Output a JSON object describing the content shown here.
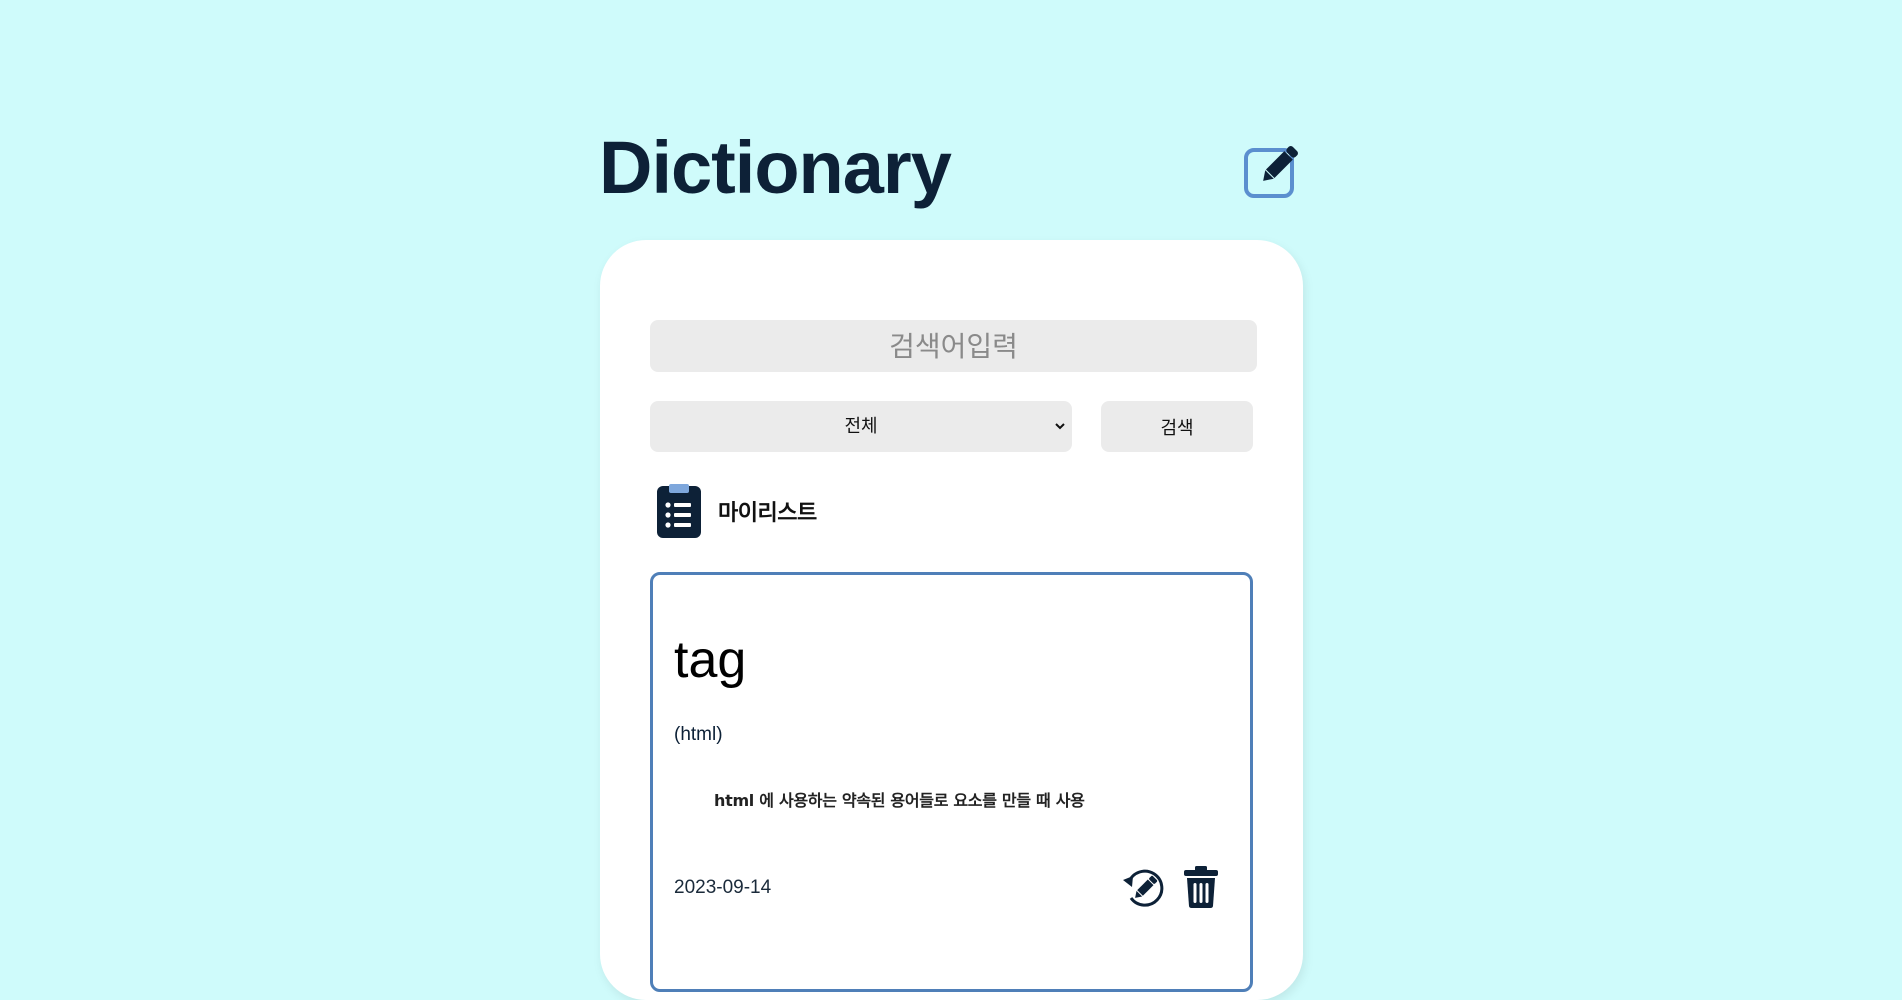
{
  "header": {
    "title": "Dictionary",
    "write_icon": "pen-to-square-icon"
  },
  "search": {
    "placeholder": "검색어입력",
    "value": ""
  },
  "filter": {
    "selected": "전체",
    "options": [
      "전체"
    ]
  },
  "search_button": {
    "label": "검색"
  },
  "mylist": {
    "icon": "clipboard-list-icon",
    "label": "마이리스트"
  },
  "words": [
    {
      "term": "tag",
      "category": "(html)",
      "description": "html 에 사용하는 약속된 용어들로 요소를 만들 때 사용",
      "date": "2023-09-14",
      "edit_icon": "rotate-pen-icon",
      "delete_icon": "trash-icon"
    }
  ],
  "colors": {
    "background": "#cffbfb",
    "primary_text": "#0d2137",
    "accent_border": "#4f7fb8",
    "input_background": "#ebebeb",
    "panel_background": "#ffffff"
  }
}
